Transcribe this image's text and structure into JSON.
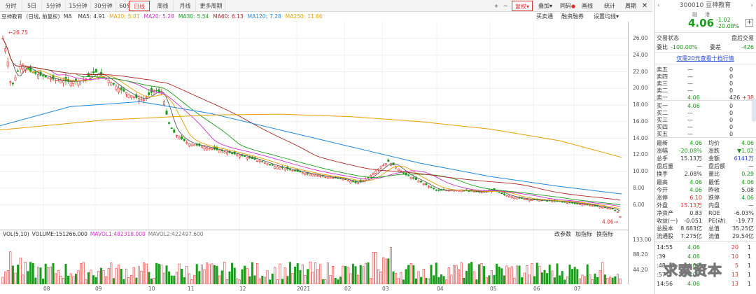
{
  "toolbar": {
    "tabs": [
      "分时",
      "5日",
      "5分钟",
      "15分钟",
      "30分钟",
      "60分钟",
      "日线",
      "周线",
      "月线",
      "更多周期"
    ],
    "active_tab": "日线",
    "right_tools": {
      "plus": "+",
      "minus": "−",
      "fuquan": "复权",
      "diejia": "叠加",
      "tongma": "同码",
      "huaxian": "画线",
      "tongjie": "统计",
      "zhouqi": "周期"
    }
  },
  "legend": {
    "stock_name": "豆神教育",
    "mode": "(日线, 前复权)",
    "ma": [
      {
        "label": "MA",
        "value": "",
        "color": "#333333"
      },
      {
        "label": "MA5:",
        "value": "4.91",
        "color": "#333333"
      },
      {
        "label": "MA10:",
        "value": "5.01",
        "color": "#e6a000"
      },
      {
        "label": "MA20:",
        "value": "5.28",
        "color": "#cc33cc"
      },
      {
        "label": "MA30:",
        "value": "5.54",
        "color": "#1b9b1b"
      },
      {
        "label": "MA60:",
        "value": "6.13",
        "color": "#b02828"
      },
      {
        "label": "MA120:",
        "value": "7.28",
        "color": "#2288dd"
      },
      {
        "label": "MA250:",
        "value": "11.66",
        "color": "#e6a000"
      }
    ],
    "links": [
      "买卖通",
      "融资融券",
      "设置均线"
    ]
  },
  "price_axis": [
    "26.00",
    "24.00",
    "22.00",
    "20.00",
    "18.00",
    "16.00",
    "14.00",
    "12.00",
    "10.00",
    "8.00",
    "6.00"
  ],
  "vol_axis": [
    "133.00",
    "88.20",
    "44.20"
  ],
  "time_axis": [
    "08",
    "09",
    "10",
    "11",
    "12",
    "2021",
    "02",
    "03",
    "04",
    "05",
    "06",
    "07"
  ],
  "annotations": {
    "high": "26.75",
    "low": "4.06"
  },
  "volume": {
    "legend": [
      {
        "text": "VOL(5,10)",
        "color": "#333333"
      },
      {
        "text": "VOLUME:151266.000",
        "color": "#333333"
      },
      {
        "text": "MAVOL1:482318.000",
        "color": "#cc33cc"
      },
      {
        "text": "MAVOL2:422497.600",
        "color": "#777777"
      }
    ],
    "tools": [
      "改参数",
      "加指标",
      "换指标"
    ]
  },
  "colors": {
    "up": "#e03030",
    "down": "#1b9b1b",
    "ma5": "#555555",
    "ma10": "#e6a000",
    "ma20": "#cc33cc",
    "ma30": "#1b9b1b",
    "ma60": "#b02828",
    "ma120": "#2288dd",
    "ma250": "#e6a000"
  },
  "side": {
    "code": "300010",
    "name": "豆神教育",
    "price": "4.06",
    "badge1": "融",
    "badge2": "港",
    "change": "-1.02",
    "pct": "-20.08%",
    "status_label": "交易状态",
    "status_value": "盘后交易",
    "weibi_label": "委比",
    "weibi": "-100.00%",
    "weicha_label": "委差",
    "weicha": "-426",
    "link": "仅需20元查看十档行情",
    "asks": [
      {
        "label": "卖五",
        "price": "—",
        "vol": "0",
        "chg": ""
      },
      {
        "label": "卖四",
        "price": "—",
        "vol": "0",
        "chg": ""
      },
      {
        "label": "卖三",
        "price": "—",
        "vol": "0",
        "chg": ""
      },
      {
        "label": "卖二",
        "price": "—",
        "vol": "0",
        "chg": ""
      },
      {
        "label": "卖一",
        "price": "4.06",
        "vol": "426",
        "chg": "+38"
      }
    ],
    "bids": [
      {
        "label": "买一",
        "price": "4.06",
        "vol": "0"
      },
      {
        "label": "买二",
        "price": "—",
        "vol": "0"
      },
      {
        "label": "买三",
        "price": "—",
        "vol": "0"
      },
      {
        "label": "买四",
        "price": "—",
        "vol": "0"
      },
      {
        "label": "买五",
        "price": "—",
        "vol": "0"
      }
    ],
    "stats": [
      {
        "l1": "最新",
        "v1": "4.06",
        "c1": "green",
        "l2": "均价",
        "v2": "4.06",
        "c2": "green"
      },
      {
        "l1": "涨幅",
        "v1": "-20.08%",
        "c1": "green",
        "l2": "涨跌",
        "v2": "▼1.02",
        "c2": "green"
      },
      {
        "l1": "总手",
        "v1": "15.13万",
        "c1": "",
        "l2": "金额",
        "v2": "6141万",
        "c2": "blue"
      },
      {
        "l1": "盘后量",
        "v1": "—",
        "c1": "",
        "l2": "盘后额",
        "v2": "—",
        "c2": ""
      },
      {
        "l1": "换手",
        "v1": "2.08%",
        "c1": "",
        "l2": "量比",
        "v2": "0.29",
        "c2": "green"
      },
      {
        "l1": "最高",
        "v1": "4.06",
        "c1": "green",
        "l2": "最低",
        "v2": "4.06",
        "c2": "green"
      },
      {
        "l1": "今开",
        "v1": "4.06",
        "c1": "green",
        "l2": "昨收",
        "v2": "5.08",
        "c2": ""
      },
      {
        "l1": "涨停",
        "v1": "6.10",
        "c1": "red",
        "l2": "跌停",
        "v2": "4.06",
        "c2": "green"
      },
      {
        "l1": "外盘",
        "v1": "15.13万",
        "c1": "red",
        "l2": "内盘",
        "v2": "—",
        "c2": ""
      },
      {
        "l1": "净资产",
        "v1": "0.83",
        "c1": "",
        "l2": "ROE",
        "v2": "-6.03%",
        "c2": ""
      },
      {
        "l1": "收益(一)",
        "v1": "-0.051",
        "c1": "",
        "l2": "PE(动)",
        "v2": "-19.77",
        "c2": ""
      },
      {
        "l1": "总股本",
        "v1": "8.683亿",
        "c1": "",
        "l2": "总值",
        "v2": "35.25亿",
        "c2": ""
      },
      {
        "l1": "流通股",
        "v1": "7.275亿",
        "c1": "",
        "l2": "流值",
        "v2": "29.54亿",
        "c2": ""
      }
    ],
    "ticks": [
      {
        "time": "14:55",
        "price": "4.06",
        "vol": "20",
        "n": "1"
      },
      {
        "time": ":39",
        "price": "4.06",
        "vol": "10",
        "n": "1"
      },
      {
        "time": ":48",
        "price": "4.06",
        "vol": "5",
        "n": "1"
      },
      {
        "time": ":57",
        "price": "4.06",
        "vol": "13",
        "n": "1"
      },
      {
        "time": "14:56",
        "price": "4.06",
        "vol": "13",
        "n": "1"
      }
    ]
  },
  "watermark": "求索资本"
}
